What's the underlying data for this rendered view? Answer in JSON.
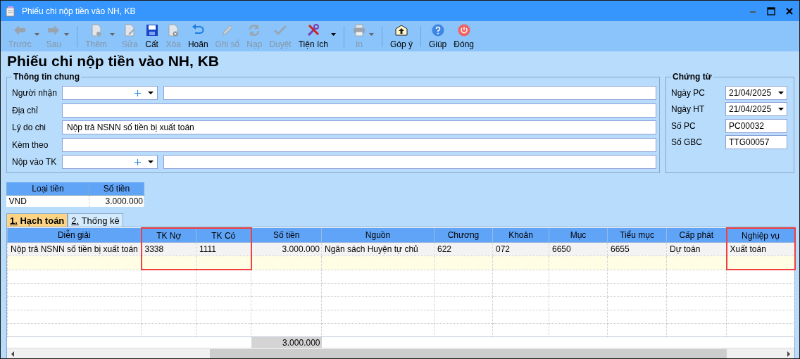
{
  "window": {
    "title": "Phiếu chi nộp tiền vào NH, KB"
  },
  "toolbar": [
    {
      "kind": "button",
      "label": "Trước",
      "disabled": true,
      "dropdown": true
    },
    {
      "kind": "button",
      "label": "Sau",
      "disabled": true,
      "dropdown": true
    },
    {
      "kind": "separator"
    },
    {
      "kind": "button",
      "label": "Thêm",
      "disabled": true,
      "dropdown": true
    },
    {
      "kind": "button",
      "label": "Sửa",
      "disabled": true,
      "dropdown": false
    },
    {
      "kind": "button",
      "label": "Cất",
      "disabled": false,
      "dropdown": false
    },
    {
      "kind": "button",
      "label": "Xóa",
      "disabled": true,
      "dropdown": false
    },
    {
      "kind": "button",
      "label": "Hoãn",
      "disabled": false,
      "dropdown": false
    },
    {
      "kind": "button",
      "label": "Ghi sổ",
      "disabled": true,
      "dropdown": false
    },
    {
      "kind": "button",
      "label": "Nạp",
      "disabled": true,
      "dropdown": false
    },
    {
      "kind": "button",
      "label": "Duyệt",
      "disabled": true,
      "dropdown": false
    },
    {
      "kind": "button",
      "label": "Tiện ích",
      "disabled": false,
      "dropdown": true
    },
    {
      "kind": "separator"
    },
    {
      "kind": "button",
      "label": "In",
      "disabled": true,
      "dropdown": true
    },
    {
      "kind": "separator"
    },
    {
      "kind": "button",
      "label": "Góp ý",
      "disabled": false,
      "dropdown": false
    },
    {
      "kind": "separator"
    },
    {
      "kind": "button",
      "label": "Giúp",
      "disabled": false,
      "dropdown": false
    },
    {
      "kind": "button",
      "label": "Đóng",
      "disabled": false,
      "dropdown": false
    }
  ],
  "heading": "Phiếu chi nộp tiền vào NH, KB",
  "general": {
    "title": "Thông tin chung",
    "fields": [
      {
        "label": "Người nhận",
        "kind": "combo"
      },
      {
        "label": "Địa chỉ",
        "kind": "text"
      },
      {
        "label": "Lý do chi",
        "kind": "text",
        "value": "Nộp trả NSNN số tiền bị xuất toán"
      },
      {
        "label": "Kèm theo",
        "kind": "text"
      },
      {
        "label": "Nộp vào TK",
        "kind": "combo"
      }
    ]
  },
  "voucher": {
    "title": "Chứng từ",
    "fields": [
      {
        "label": "Ngày PC",
        "kind": "date",
        "value": "21/04/2025"
      },
      {
        "label": "Ngày HT",
        "kind": "date",
        "value": "21/04/2025"
      },
      {
        "label": "Số PC",
        "kind": "text",
        "value": "PC00032"
      },
      {
        "label": "Số GBC",
        "kind": "text",
        "value": "TTG00057"
      }
    ]
  },
  "currency_table": {
    "columns": [
      "Loại tiền",
      "Số tiền"
    ],
    "rows": [
      [
        "VND",
        "3.000.000"
      ]
    ]
  },
  "tabs": [
    {
      "label": "1. Hạch toán",
      "selected": true
    },
    {
      "label": "2. Thống kê",
      "selected": false
    }
  ],
  "grid": {
    "columns": [
      {
        "label": "Diễn giải",
        "kind": "text",
        "highlighted": false
      },
      {
        "label": "TK Nợ",
        "kind": "text",
        "highlighted": true
      },
      {
        "label": "TK Có",
        "kind": "text",
        "highlighted": true
      },
      {
        "label": "Số tiền",
        "kind": "amount",
        "highlighted": false
      },
      {
        "label": "Nguồn",
        "kind": "text",
        "highlighted": false
      },
      {
        "label": "Chương",
        "kind": "text",
        "highlighted": false
      },
      {
        "label": "Khoản",
        "kind": "text",
        "highlighted": false
      },
      {
        "label": "Mục",
        "kind": "text",
        "highlighted": false
      },
      {
        "label": "Tiểu mục",
        "kind": "text",
        "highlighted": false
      },
      {
        "label": "Cấp phát",
        "kind": "text",
        "highlighted": false
      },
      {
        "label": "Nghiệp vụ",
        "kind": "text",
        "highlighted": true
      }
    ],
    "rows": [
      [
        "Nộp trả NSNN số tiền bị xuất toán",
        "3338",
        "1111",
        "3.000.000",
        "Ngân sách Huyện tự chủ",
        "622",
        "072",
        "6650",
        "6655",
        "Dự toán",
        "Xuất toán"
      ]
    ],
    "total": "3.000.000"
  }
}
